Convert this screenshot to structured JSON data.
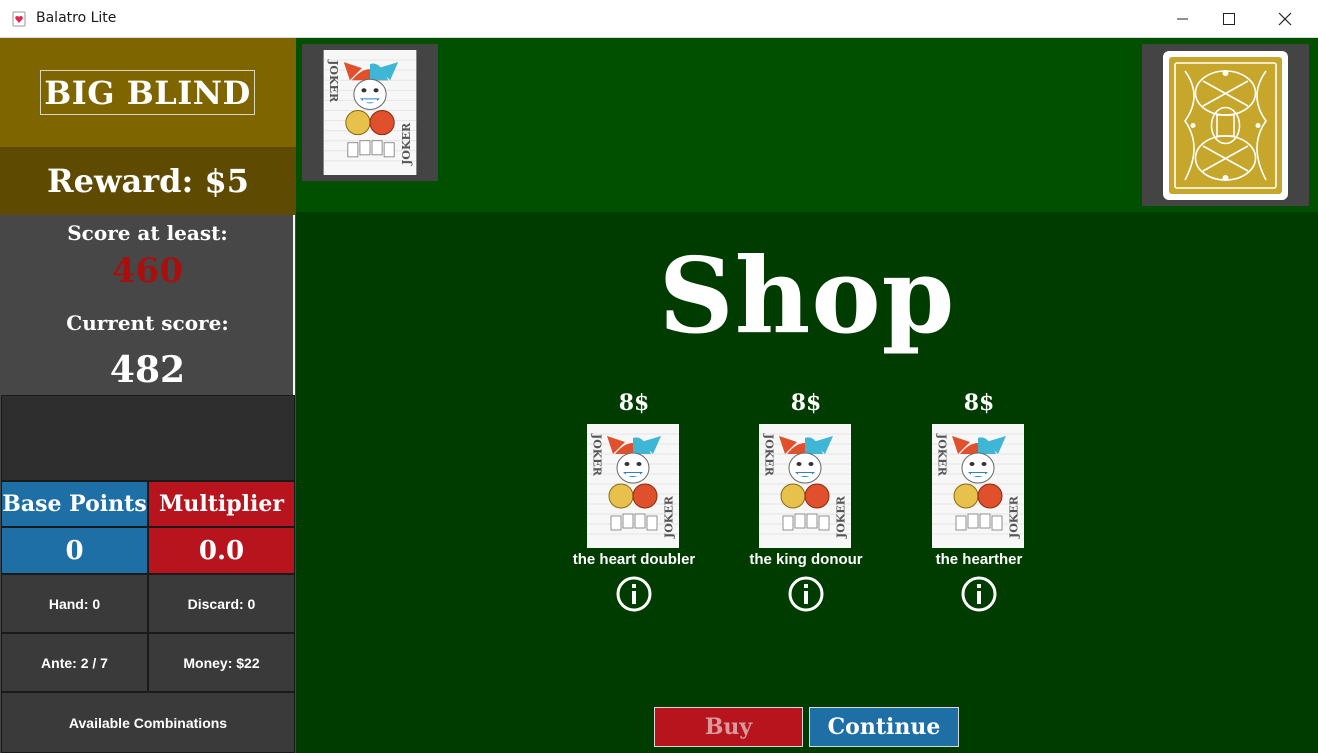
{
  "window": {
    "title": "Balatro Lite",
    "controls": [
      "minimize",
      "maximize",
      "close"
    ]
  },
  "sidebar": {
    "blind_title": "BIG BLIND",
    "reward": "Reward: $5",
    "score_label": "Score at least:",
    "score_target": "460",
    "current_label": "Current score:",
    "current_score": "482",
    "base_points_label": "Base Points",
    "multiplier_label": "Multiplier",
    "base_points_value": "0",
    "multiplier_value": "0.0",
    "hand": "Hand: 0",
    "discard": "Discard: 0",
    "ante": "Ante: 2 / 7",
    "money": "Money: $22",
    "combinations_button": "Available Combinations"
  },
  "topbar": {
    "owned_joker_icon": "joker-card",
    "deck_icon": "card-back"
  },
  "shop": {
    "title": "Shop",
    "items": [
      {
        "price": "8$",
        "name": "the heart doubler",
        "icon": "joker-card"
      },
      {
        "price": "8$",
        "name": "the king donour",
        "icon": "joker-card"
      },
      {
        "price": "8$",
        "name": "the hearther",
        "icon": "joker-card"
      }
    ],
    "buy_label": "Buy",
    "continue_label": "Continue"
  },
  "colors": {
    "blind_bg": "#7e6500",
    "reward_bg": "#5e4a00",
    "score_target": "#a81010",
    "base_points": "#1f6fa7",
    "multiplier": "#b8141e",
    "topbar_green": "#005000",
    "main_green": "#003c00"
  }
}
